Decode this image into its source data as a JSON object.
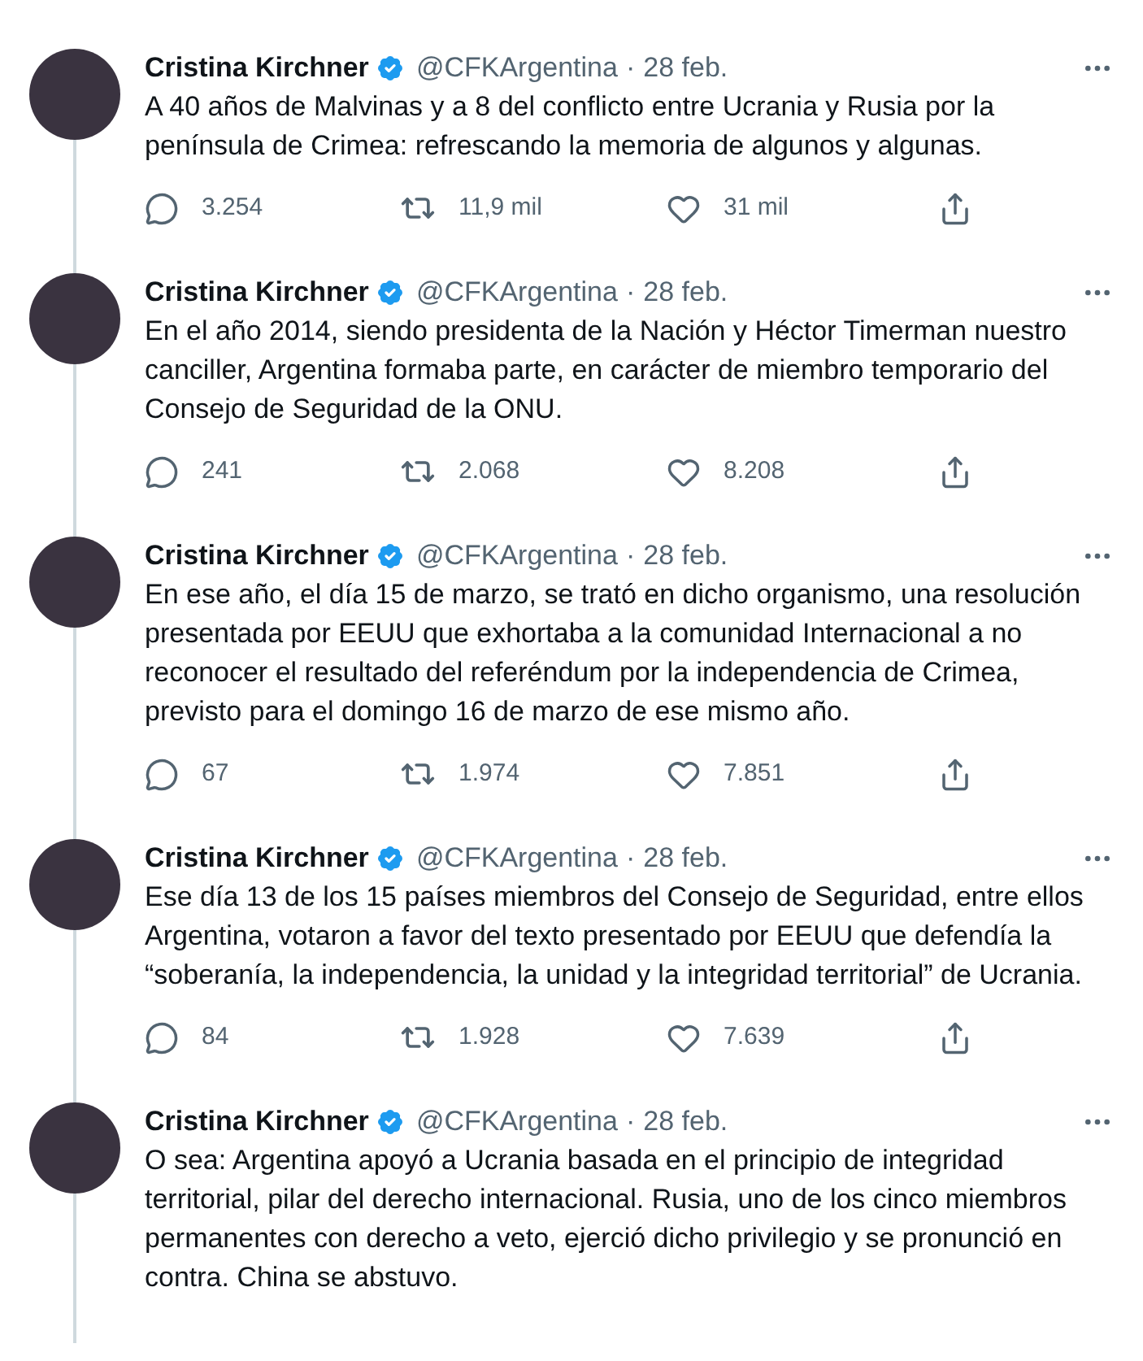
{
  "tweets": [
    {
      "name": "Cristina Kirchner",
      "verified": true,
      "handle": "@CFKArgentina",
      "separator": "·",
      "date": "28 feb.",
      "text": "A 40 años de Malvinas y a 8 del conflicto entre Ucrania y Rusia por la península de Crimea: refrescando la memoria de algunos y algunas.",
      "replies": "3.254",
      "retweets": "11,9 mil",
      "likes": "31 mil",
      "thread_line": true
    },
    {
      "name": "Cristina Kirchner",
      "verified": true,
      "handle": "@CFKArgentina",
      "separator": "·",
      "date": "28 feb.",
      "text": "En el año 2014, siendo presidenta de la Nación y Héctor Timerman nuestro canciller, Argentina formaba parte, en carácter de miembro temporario del Consejo de Seguridad de la ONU.",
      "replies": "241",
      "retweets": "2.068",
      "likes": "8.208",
      "thread_line": true
    },
    {
      "name": "Cristina Kirchner",
      "verified": true,
      "handle": "@CFKArgentina",
      "separator": "·",
      "date": "28 feb.",
      "text": "En ese año, el día 15 de marzo, se trató en dicho organismo, una resolución presentada por EEUU que exhortaba a la comunidad Internacional a no reconocer el resultado del referéndum por la independencia de Crimea, previsto para el domingo 16 de marzo de ese mismo año.",
      "replies": "67",
      "retweets": "1.974",
      "likes": "7.851",
      "thread_line": true
    },
    {
      "name": "Cristina Kirchner",
      "verified": true,
      "handle": "@CFKArgentina",
      "separator": "·",
      "date": "28 feb.",
      "text": "Ese día 13 de los 15 países miembros del Consejo de Seguridad, entre ellos Argentina, votaron a favor del texto presentado por EEUU que defendía la “soberanía, la independencia, la unidad y la integridad territorial” de Ucrania.",
      "replies": "84",
      "retweets": "1.928",
      "likes": "7.639",
      "thread_line": true
    },
    {
      "name": "Cristina Kirchner",
      "verified": true,
      "handle": "@CFKArgentina",
      "separator": "·",
      "date": "28 feb.",
      "text": "O sea: Argentina apoyó a Ucrania basada en el principio de integridad territorial, pilar del derecho internacional. Rusia, uno de los cinco miembros permanentes con derecho a veto, ejerció dicho privilegio y se pronunció en contra. China se abstuvo.",
      "thread_line": true
    }
  ]
}
